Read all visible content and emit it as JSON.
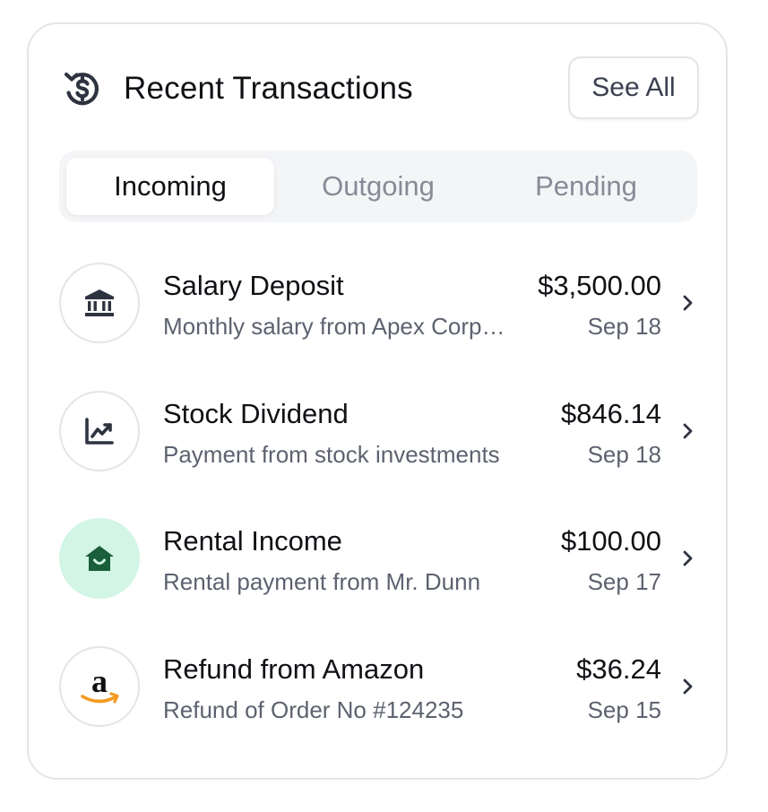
{
  "header": {
    "title": "Recent Transactions",
    "title_icon": "dollar-refresh-icon",
    "see_all_label": "See All"
  },
  "tabs": [
    {
      "label": "Incoming",
      "active": true
    },
    {
      "label": "Outgoing",
      "active": false
    },
    {
      "label": "Pending",
      "active": false
    }
  ],
  "transactions": [
    {
      "title": "Salary Deposit",
      "subtitle": "Monthly salary from Apex Corporation",
      "amount": "$3,500.00",
      "date": "Sep 18",
      "icon": "bank-icon"
    },
    {
      "title": "Stock Dividend",
      "subtitle": "Payment from stock investments",
      "amount": "$846.14",
      "date": "Sep 18",
      "icon": "chart-up-icon"
    },
    {
      "title": "Rental Income",
      "subtitle": "Rental payment from Mr. Dunn",
      "amount": "$100.00",
      "date": "Sep 17",
      "icon": "house-icon"
    },
    {
      "title": "Refund from Amazon",
      "subtitle": "Refund of Order No #124235",
      "amount": "$36.24",
      "date": "Sep 15",
      "icon": "amazon-logo-icon"
    }
  ],
  "colors": {
    "text_primary": "#0f1115",
    "text_secondary": "#5d6270",
    "tab_inactive": "#868b96",
    "border": "#e3e5e9",
    "tab_track": "#f4f5f7",
    "rental_bg": "#d2f5e5",
    "rental_icon": "#1b5e3b",
    "amazon_orange": "#f39a1e"
  }
}
